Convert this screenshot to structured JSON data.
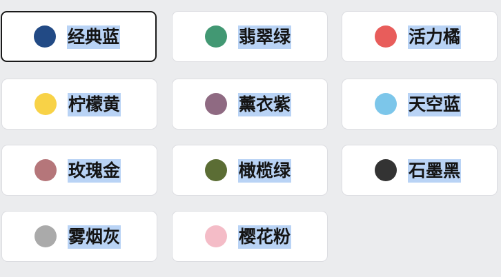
{
  "palette": {
    "selected_index": 0,
    "swatches": [
      {
        "label": "经典蓝",
        "color": "#224a85"
      },
      {
        "label": "翡翠绿",
        "color": "#429873"
      },
      {
        "label": "活力橘",
        "color": "#e85d5b"
      },
      {
        "label": "柠檬黄",
        "color": "#f8d247"
      },
      {
        "label": "薰衣紫",
        "color": "#8f6a82"
      },
      {
        "label": "天空蓝",
        "color": "#7cc6ea"
      },
      {
        "label": "玫瑰金",
        "color": "#b5767a"
      },
      {
        "label": "橄榄绿",
        "color": "#5b6d34"
      },
      {
        "label": "石墨黑",
        "color": "#333333"
      },
      {
        "label": "雾烟灰",
        "color": "#aaaaaa"
      },
      {
        "label": "樱花粉",
        "color": "#f4bcc7"
      }
    ]
  }
}
